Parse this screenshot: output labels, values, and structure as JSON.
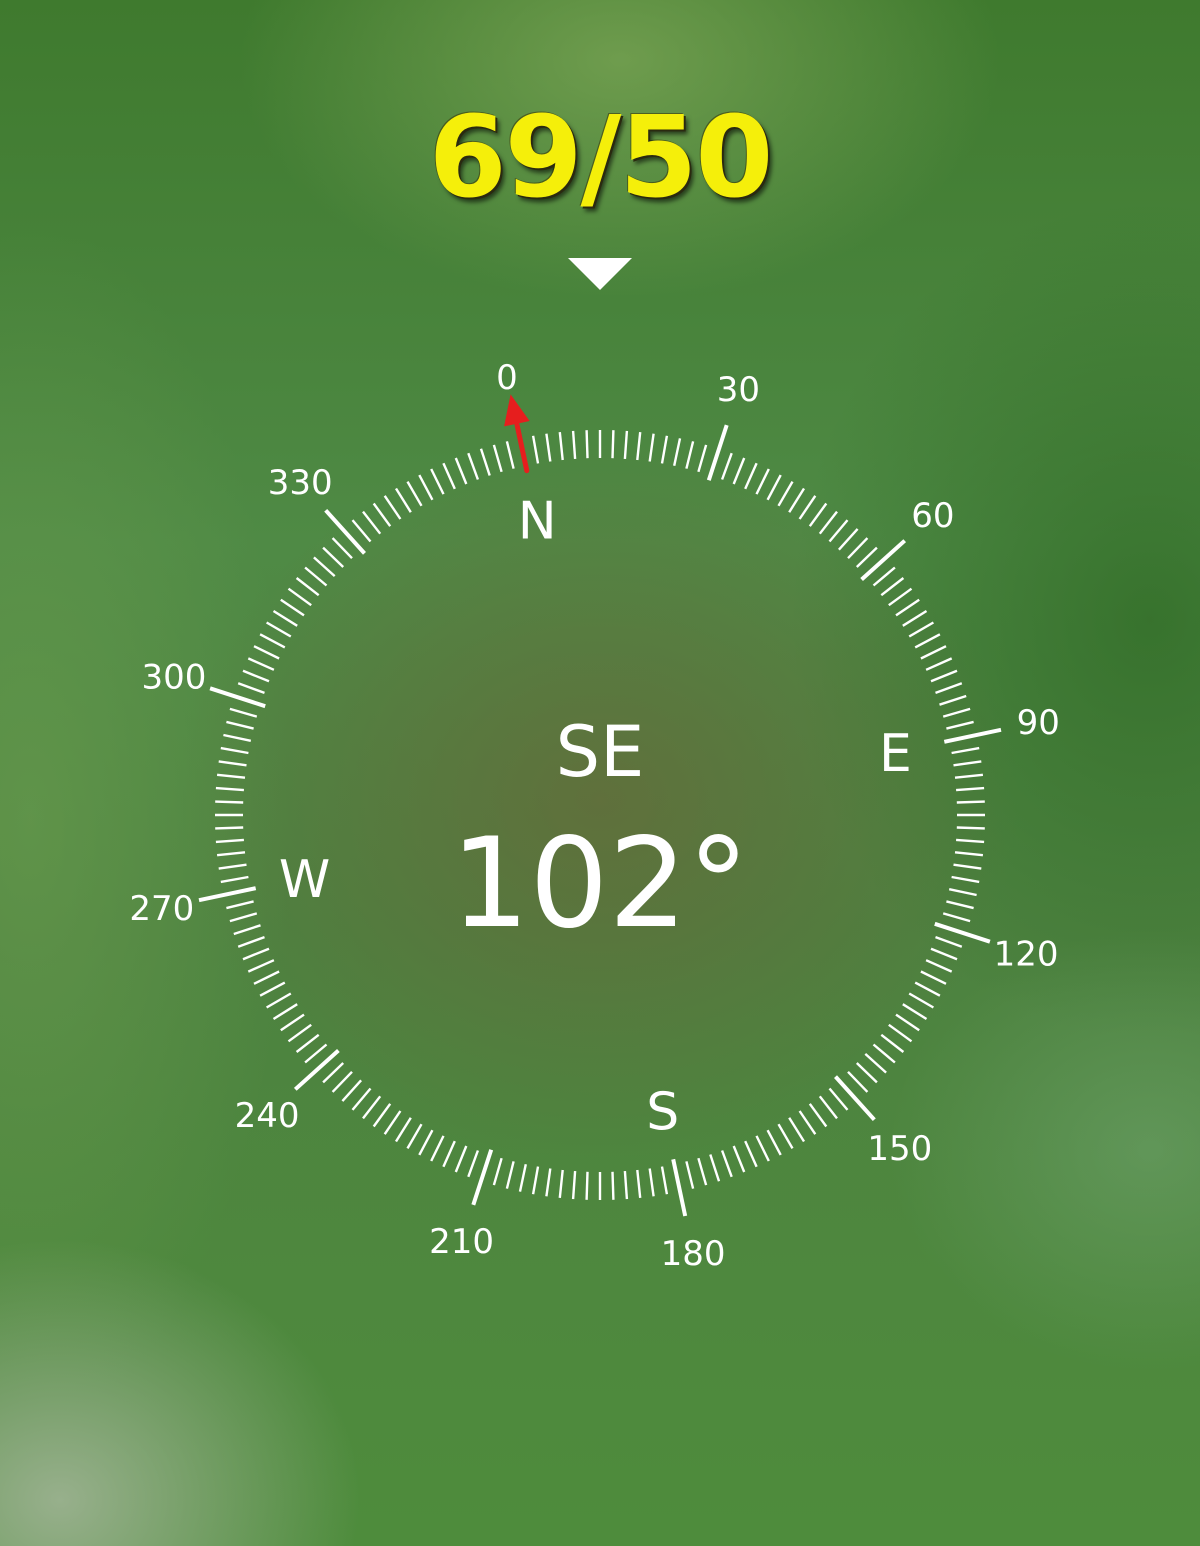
{
  "score": "69/50",
  "compass": {
    "heading_degrees": 102,
    "heading_text": "102°",
    "direction": "SE",
    "cardinals": [
      {
        "label": "N",
        "bearing": 0
      },
      {
        "label": "E",
        "bearing": 90
      },
      {
        "label": "S",
        "bearing": 180
      },
      {
        "label": "W",
        "bearing": 270
      }
    ],
    "degree_labels": [
      "0",
      "30",
      "60",
      "90",
      "120",
      "150",
      "180",
      "210",
      "240",
      "270",
      "300",
      "330"
    ],
    "north_arrow_color": "#e61e1e"
  },
  "icons": {
    "heading_marker": "triangle-down-icon",
    "north_arrow": "arrow-left-icon"
  }
}
